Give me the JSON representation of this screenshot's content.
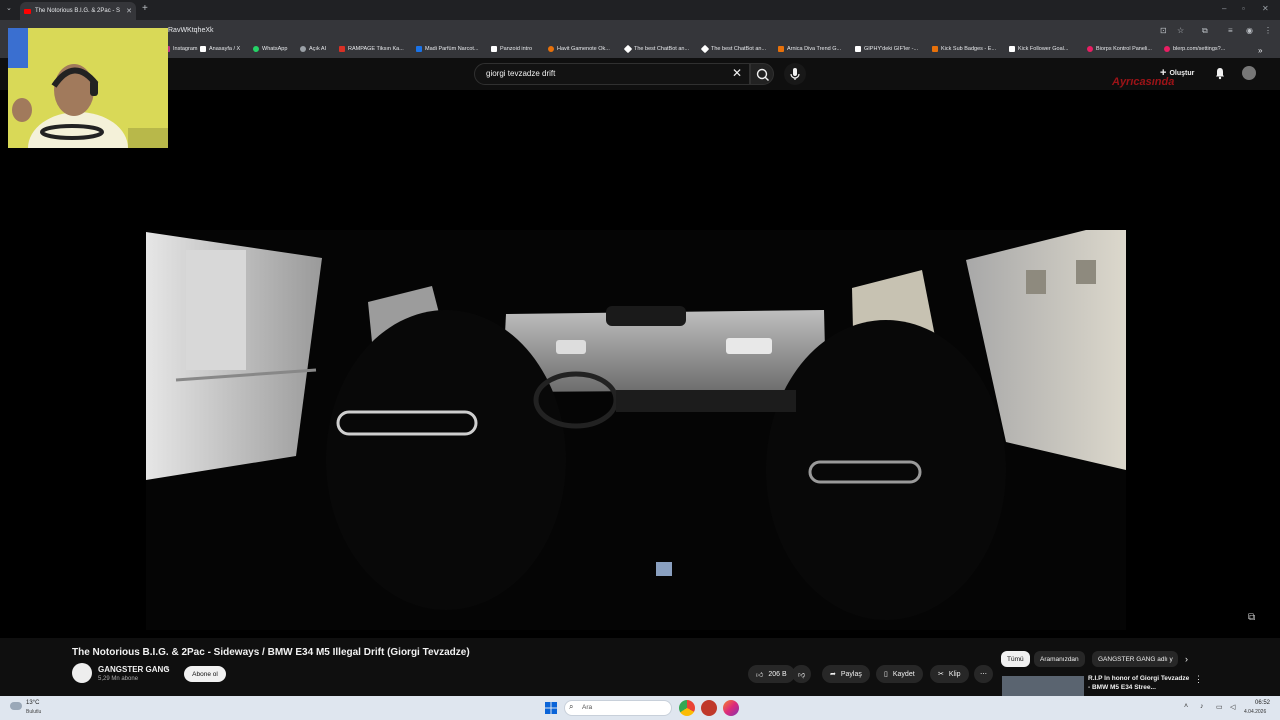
{
  "browser": {
    "active_tab_title": "The Notorious B.I.G. & 2Pac - S",
    "url_fragment": "RavWKtqheXk",
    "bookmarks": [
      {
        "label": "Instagram",
        "color": "#c13584"
      },
      {
        "label": "Anasayfa / X",
        "color": "#ffffff"
      },
      {
        "label": "WhatsApp",
        "color": "#25d366"
      },
      {
        "label": "Açık AI",
        "color": "#9aa0a6"
      },
      {
        "label": "RAMPAGE Tiksın Ka...",
        "color": "#d93025"
      },
      {
        "label": "Madi Parfüm Narcot...",
        "color": "#1a73e8"
      },
      {
        "label": "Panzoid intro",
        "color": "#ffffff"
      },
      {
        "label": "Havit Gamenote Ok...",
        "color": "#e8710a"
      },
      {
        "label": "The best ChatBot an...",
        "color": "#ffffff"
      },
      {
        "label": "The best ChatBot an...",
        "color": "#ffffff"
      },
      {
        "label": "Arnica Diva Trend G...",
        "color": "#e8710a"
      },
      {
        "label": "GIPHY'deki GIF'ler -...",
        "color": "#ffffff"
      },
      {
        "label": "Kick Sub Badges - E...",
        "color": "#e8710a"
      },
      {
        "label": "Kick Follower Goal...",
        "color": "#ffffff"
      },
      {
        "label": "Biorps Kontrol Paneli...",
        "color": "#e91e63"
      },
      {
        "label": "blerp.com/settings?...",
        "color": "#e91e63"
      }
    ]
  },
  "youtube": {
    "search_value": "giorgi tevzadze drift",
    "create_label": "Oluştur",
    "logo_overlay": "Ayrıcasında",
    "video_title": "The Notorious B.I.G. & 2Pac - Sideways / BMW E34 M5 Illegal Drift (Giorgi Tevzadze)",
    "channel_name": "GANGSTER GANG",
    "subscribers": "5,29 Mn abone",
    "subscribe_label": "Abone ol",
    "likes": "206 B",
    "share_label": "Paylaş",
    "save_label": "Kaydet",
    "clip_label": "Klip",
    "chips": [
      "Tümü",
      "Aramanızdan",
      "GANGSTER GANG adlı y"
    ],
    "recommended_title": "R.I.P In honor of Giorgi Tevzadze - BMW M5 E34 Stree..."
  },
  "taskbar": {
    "temperature": "13°C",
    "weather": "Bulutlu",
    "search_placeholder": "Ara",
    "time": "06:52",
    "date": "4.04.2026"
  }
}
